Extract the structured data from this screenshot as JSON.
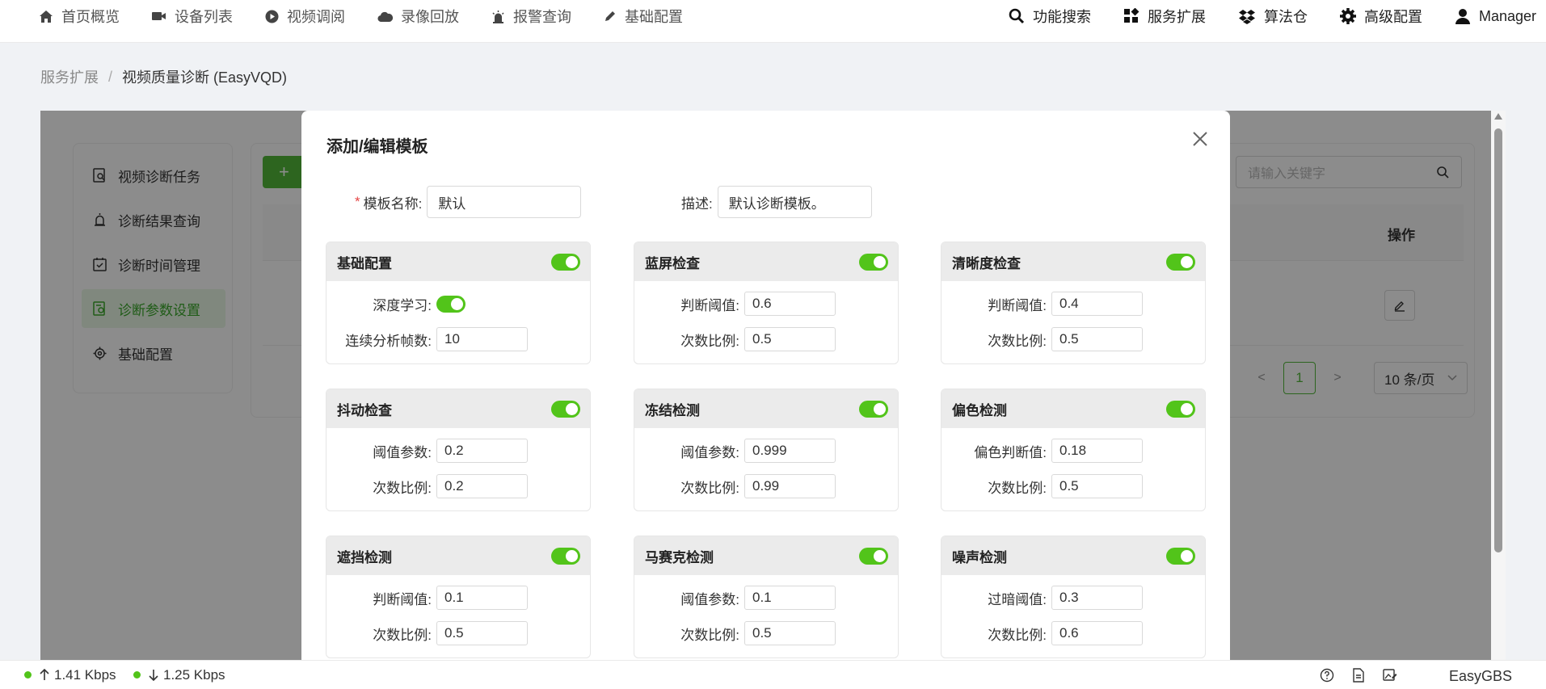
{
  "nav": {
    "left": [
      {
        "label": "首页概览",
        "icon": "home-icon"
      },
      {
        "label": "设备列表",
        "icon": "camera-icon"
      },
      {
        "label": "视频调阅",
        "icon": "play-icon"
      },
      {
        "label": "录像回放",
        "icon": "cloud-icon"
      },
      {
        "label": "报警查询",
        "icon": "alarm-icon"
      },
      {
        "label": "基础配置",
        "icon": "pen-icon"
      }
    ],
    "right": [
      {
        "label": "功能搜索",
        "icon": "search-icon"
      },
      {
        "label": "服务扩展",
        "icon": "grid-icon"
      },
      {
        "label": "算法仓",
        "icon": "dropbox-icon"
      },
      {
        "label": "高级配置",
        "icon": "gear-icon"
      },
      {
        "label": "Manager",
        "icon": "user-icon"
      }
    ]
  },
  "breadcrumb": {
    "parent": "服务扩展",
    "sep": "/",
    "current": "视频质量诊断 (EasyVQD)"
  },
  "sidebar": {
    "items": [
      {
        "label": "视频诊断任务"
      },
      {
        "label": "诊断结果查询"
      },
      {
        "label": "诊断时间管理"
      },
      {
        "label": "诊断参数设置",
        "active": true
      },
      {
        "label": "基础配置"
      }
    ]
  },
  "main": {
    "add_label": "+",
    "search_placeholder": "请输入关键字",
    "col_ops": "操作",
    "pager": {
      "prev": "<",
      "page": "1",
      "next": ">",
      "size": "10 条/页"
    }
  },
  "modal": {
    "title": "添加/编辑模板",
    "name_label": "模板名称:",
    "name_value": "默认",
    "desc_label": "描述:",
    "desc_value": "默认诊断模板。",
    "panels": [
      {
        "title": "基础配置",
        "enabled": true,
        "rows": [
          {
            "label": "深度学习:",
            "toggle": true
          },
          {
            "label": "连续分析帧数:",
            "value": "10"
          }
        ]
      },
      {
        "title": "蓝屏检查",
        "enabled": true,
        "rows": [
          {
            "label": "判断阈值:",
            "value": "0.6"
          },
          {
            "label": "次数比例:",
            "value": "0.5"
          }
        ]
      },
      {
        "title": "清晰度检查",
        "enabled": true,
        "rows": [
          {
            "label": "判断阈值:",
            "value": "0.4"
          },
          {
            "label": "次数比例:",
            "value": "0.5"
          }
        ]
      },
      {
        "title": "抖动检查",
        "enabled": true,
        "rows": [
          {
            "label": "阈值参数:",
            "value": "0.2"
          },
          {
            "label": "次数比例:",
            "value": "0.2"
          }
        ]
      },
      {
        "title": "冻结检测",
        "enabled": true,
        "rows": [
          {
            "label": "阈值参数:",
            "value": "0.999"
          },
          {
            "label": "次数比例:",
            "value": "0.99"
          }
        ]
      },
      {
        "title": "偏色检测",
        "enabled": true,
        "rows": [
          {
            "label": "偏色判断值:",
            "value": "0.18"
          },
          {
            "label": "次数比例:",
            "value": "0.5"
          }
        ]
      },
      {
        "title": "遮挡检测",
        "enabled": true,
        "rows": [
          {
            "label": "判断阈值:",
            "value": "0.1"
          },
          {
            "label": "次数比例:",
            "value": "0.5"
          }
        ]
      },
      {
        "title": "马赛克检测",
        "enabled": true,
        "rows": [
          {
            "label": "阈值参数:",
            "value": "0.1"
          },
          {
            "label": "次数比例:",
            "value": "0.5"
          }
        ]
      },
      {
        "title": "噪声检测",
        "enabled": true,
        "rows": [
          {
            "label": "过暗阈值:",
            "value": "0.3"
          },
          {
            "label": "次数比例:",
            "value": "0.6"
          }
        ]
      }
    ]
  },
  "status": {
    "upload": "1.41 Kbps",
    "download": "1.25 Kbps",
    "brand": "EasyGBS"
  },
  "colors": {
    "accent": "#52c41a",
    "primary": "#52b83a",
    "required": "#e54545"
  }
}
